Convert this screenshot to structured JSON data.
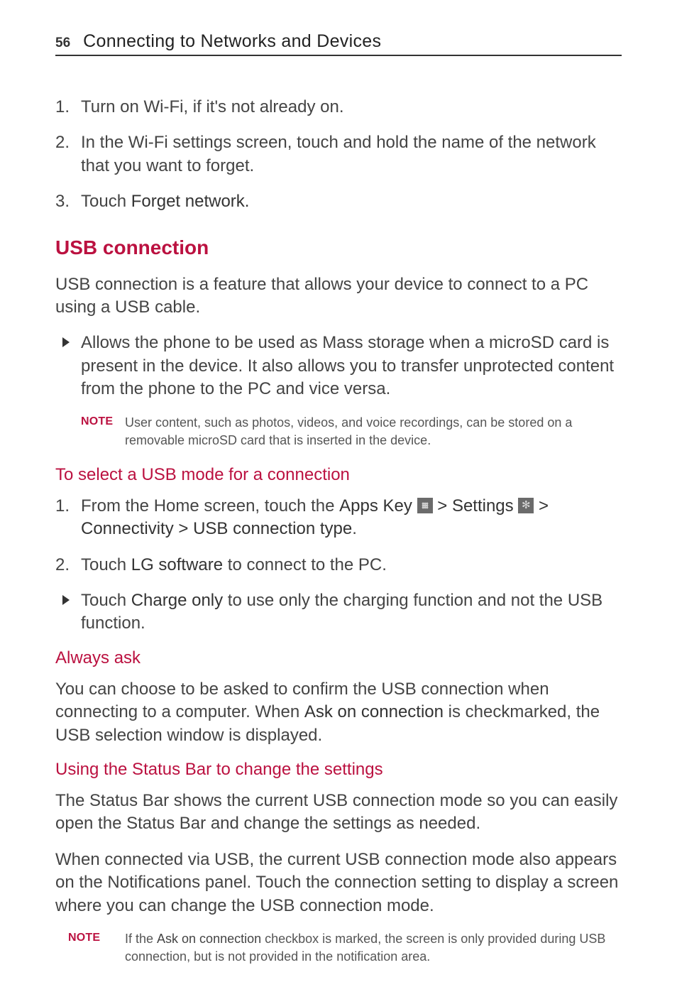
{
  "header": {
    "page_number": "56",
    "chapter_title": "Connecting to Networks and Devices"
  },
  "steps_a": {
    "s1_num": "1.",
    "s1_text": "Turn on Wi-Fi, if it's not already on.",
    "s2_num": "2.",
    "s2_text": "In the Wi-Fi settings screen, touch and hold the name of the network that you want to forget.",
    "s3_num": "3.",
    "s3_prefix": "Touch ",
    "s3_bold": "Forget network."
  },
  "usb": {
    "heading": "USB connection",
    "intro": "USB connection is a feature that allows your device to connect to a PC using a USB cable.",
    "bullet1": "Allows the phone to be used as Mass storage when a microSD card is present in the device. It also allows you to transfer unprotected content from the phone to the PC and vice versa.",
    "note_label": "NOTE",
    "note_text": "User content, such as photos, videos, and voice recordings, can be stored on a removable microSD card that is inserted in the device."
  },
  "select_mode": {
    "heading": "To select a USB mode for a connection",
    "s1_num": "1.",
    "s1_a": "From the Home screen, touch the ",
    "s1_apps": "Apps Key",
    "s1_gt1": " > ",
    "s1_set": "Settings",
    "s1_gt2": " > ",
    "s1_conn": "Connectivity",
    "s1_gt3": " > ",
    "s1_type": "USB connection type",
    "s1_dot": ".",
    "s2_num": "2.",
    "s2_a": "Touch ",
    "s2_bold": "LG software",
    "s2_b": " to connect to the PC.",
    "b_a": "Touch ",
    "b_bold": "Charge only",
    "b_b": " to use only the charging function and not the USB function."
  },
  "always_ask": {
    "heading": "Always ask",
    "p_a": "You can choose to be asked to confirm the USB connection when connecting to a computer. When ",
    "p_bold": "Ask on connection",
    "p_b": " is checkmarked, the USB selection window is displayed."
  },
  "status_bar": {
    "heading": "Using the Status Bar to change the settings",
    "p1": "The Status Bar shows the current USB connection mode so you can easily open the Status Bar and change the settings as needed.",
    "p2": "When connected via USB, the current USB connection mode also appears on the Notifications panel. Touch the connection setting to display a screen where you can change the USB connection mode.",
    "note_label": "NOTE",
    "note_a": "If the ",
    "note_bold": "Ask on connection",
    "note_b": " checkbox is marked, the screen is only provided during USB connection, but is not provided in the notification area."
  }
}
